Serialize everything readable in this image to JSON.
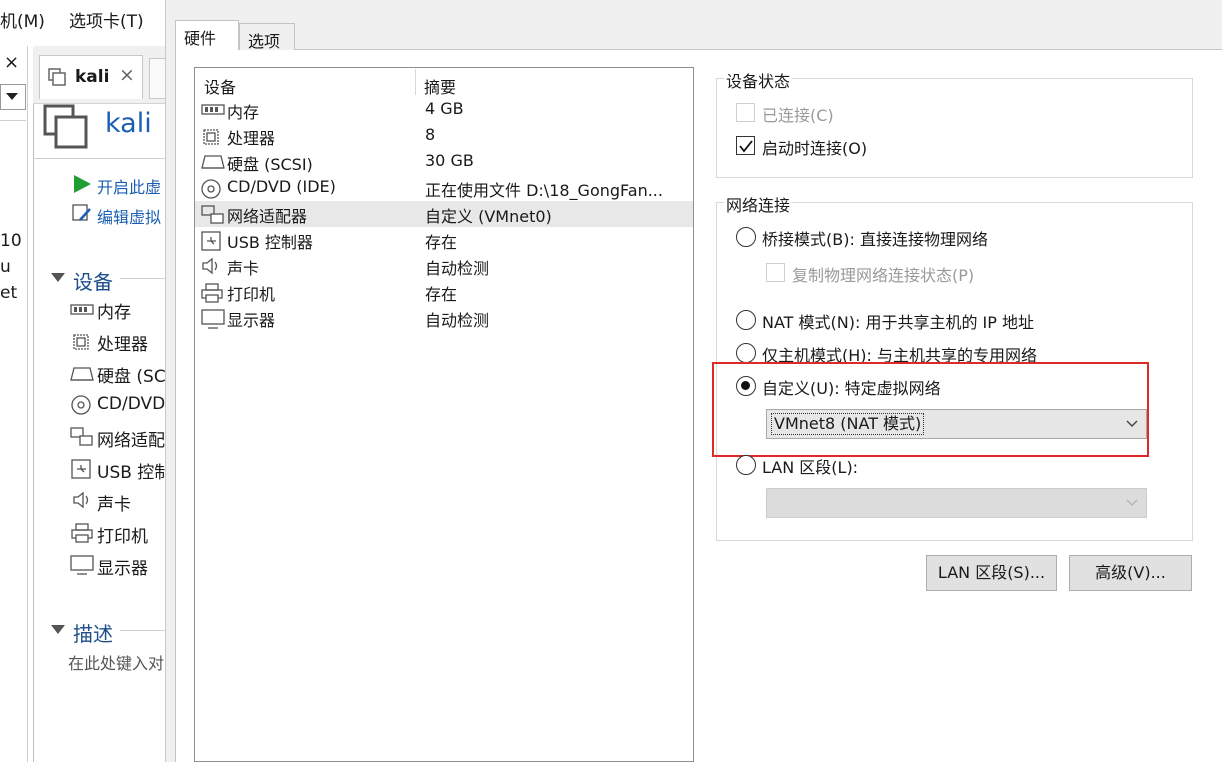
{
  "menubar": {
    "items": [
      "机(M)",
      "选项卡(T)"
    ]
  },
  "library": {
    "close_glyph": "×",
    "partial_lines": [
      "10",
      "u",
      "et"
    ]
  },
  "vm_tab": {
    "label": "kali",
    "close_glyph": "×"
  },
  "vm_panel": {
    "title": "kali",
    "actions": [
      "开启此虚",
      "编辑虚拟"
    ],
    "devices_header": "设备",
    "devices": [
      "内存",
      "处理器",
      "硬盘 (SC",
      "CD/DVD",
      "网络适配",
      "USB 控制",
      "声卡",
      "打印机",
      "显示器"
    ],
    "description_header": "描述",
    "description_placeholder": "在此处键入对"
  },
  "dialog": {
    "tabs": [
      "硬件",
      "选项"
    ],
    "device_list": {
      "headers": [
        "设备",
        "摘要"
      ],
      "rows": [
        {
          "icon": "memory-icon",
          "name": "内存",
          "summary": "4 GB"
        },
        {
          "icon": "processor-icon",
          "name": "处理器",
          "summary": "8"
        },
        {
          "icon": "harddisk-icon",
          "name": "硬盘 (SCSI)",
          "summary": "30 GB"
        },
        {
          "icon": "cd-dvd-icon",
          "name": "CD/DVD (IDE)",
          "summary": "正在使用文件 D:\\18_GongFan..."
        },
        {
          "icon": "network-adapter-icon",
          "name": "网络适配器",
          "summary": "自定义 (VMnet0)",
          "selected": true
        },
        {
          "icon": "usb-icon",
          "name": "USB 控制器",
          "summary": "存在"
        },
        {
          "icon": "sound-icon",
          "name": "声卡",
          "summary": "自动检测"
        },
        {
          "icon": "printer-icon",
          "name": "打印机",
          "summary": "存在"
        },
        {
          "icon": "display-icon",
          "name": "显示器",
          "summary": "自动检测"
        }
      ]
    },
    "device_status": {
      "title": "设备状态",
      "connected": {
        "label": "已连接(C)",
        "checked": false,
        "disabled": true
      },
      "connect_at_power_on": {
        "label": "启动时连接(O)",
        "checked": true
      }
    },
    "network_connection": {
      "title": "网络连接",
      "bridged": {
        "label": "桥接模式(B): 直接连接物理网络"
      },
      "replicate": {
        "label": "复制物理网络连接状态(P)",
        "disabled": true
      },
      "nat": {
        "label": "NAT 模式(N): 用于共享主机的 IP 地址"
      },
      "host_only": {
        "label": "仅主机模式(H): 与主机共享的专用网络"
      },
      "custom": {
        "label": "自定义(U): 特定虚拟网络",
        "selected": true,
        "value": "VMnet8 (NAT 模式)"
      },
      "lan_segment": {
        "label": "LAN 区段(L):",
        "value": ""
      }
    },
    "buttons": {
      "lan_segments": "LAN 区段(S)...",
      "advanced": "高级(V)..."
    }
  },
  "colors": {
    "highlight_box": "#e02a2a",
    "link_blue": "#1a5fb4",
    "play_green": "#1e9e33"
  }
}
